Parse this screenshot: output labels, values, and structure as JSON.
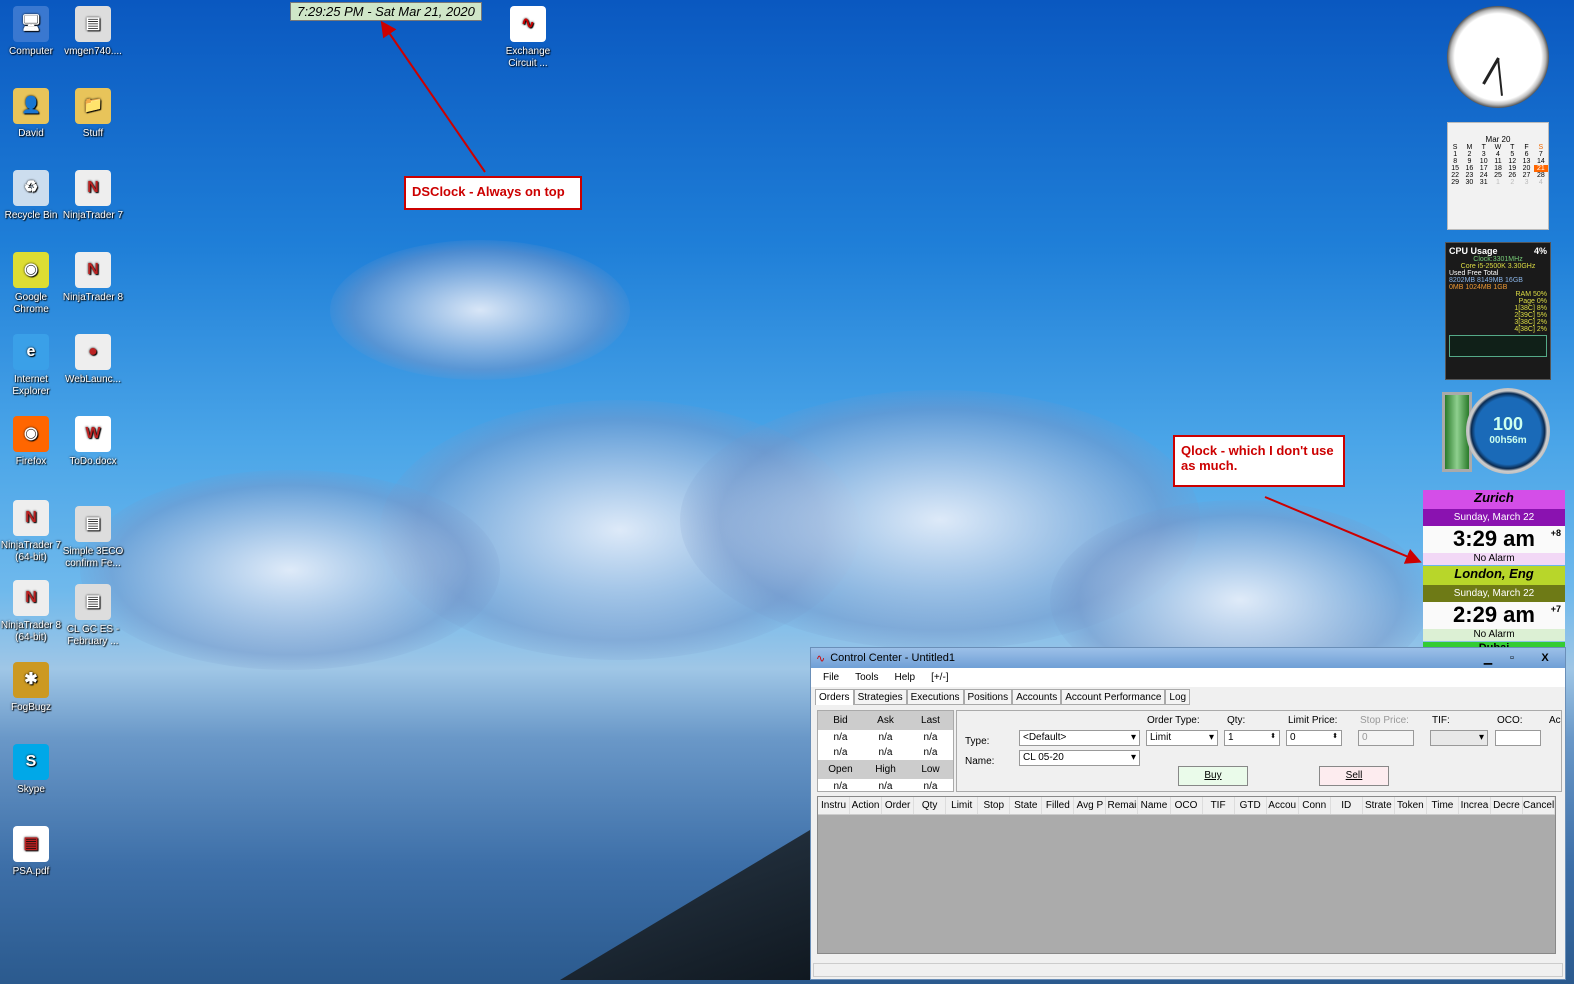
{
  "desktop": {
    "icons_col1": [
      "Computer",
      "David",
      "Recycle Bin",
      "Google Chrome",
      "Internet Explorer",
      "Firefox",
      "NinjaTrader 7 (64-bit)",
      "NinjaTrader 8 (64-bit)",
      "FogBugz",
      "Skype",
      "PSA.pdf"
    ],
    "icons_col2": [
      "vmgen740....",
      "Stuff",
      "NinjaTrader 7",
      "NinjaTrader 8",
      "WebLaunc...",
      "ToDo.docx",
      "Simple 3ECO confirm Fe...",
      "CL GC ES - February ..."
    ],
    "extra_icon": "Exchange Circuit ..."
  },
  "dsclock": "7:29:25 PM - Sat Mar 21, 2020",
  "annotations": {
    "dsclock": "DSClock - Always on top",
    "qlock": "Qlock - which I don't use as much."
  },
  "calendar": {
    "month": "Mar 20",
    "days": [
      "S",
      "M",
      "T",
      "W",
      "T",
      "F",
      "S"
    ],
    "rows": [
      [
        "1",
        "2",
        "3",
        "4",
        "5",
        "6",
        "7"
      ],
      [
        "8",
        "9",
        "10",
        "11",
        "12",
        "13",
        "14"
      ],
      [
        "15",
        "16",
        "17",
        "18",
        "19",
        "20",
        "21"
      ],
      [
        "22",
        "23",
        "24",
        "25",
        "26",
        "27",
        "28"
      ],
      [
        "29",
        "30",
        "31",
        "1",
        "2",
        "3",
        "4"
      ]
    ],
    "today": "21"
  },
  "cpu": {
    "title": "CPU Usage",
    "pct": "4%",
    "clock": "Clock:3301MHz",
    "model": "Core i5-2500K 3.30GHz",
    "cols": "Used   Free   Total",
    "mem1": "8202MB  8149MB  16GB",
    "mem2": "0MB  1024MB  1GB",
    "rows": [
      "RAM 50%",
      "Page 0%",
      "1[38C] 8%",
      "2[39C] 5%",
      "3[38C] 2%",
      "4[38C] 2%"
    ]
  },
  "battery": {
    "pct": "100",
    "time": "00h56m"
  },
  "qlock": [
    {
      "city": "Zurich",
      "date": "Sunday, March 22",
      "time": "3:29 am",
      "offset": "+8",
      "alarm": "No Alarm"
    },
    {
      "city": "London, Eng",
      "date": "Sunday, March 22",
      "time": "2:29 am",
      "offset": "+7",
      "alarm": "No Alarm"
    },
    {
      "city": "Dubai"
    }
  ],
  "window": {
    "title": "Control Center - Untitled1",
    "menu": [
      "File",
      "Tools",
      "Help",
      "[+/-]"
    ],
    "tabs": [
      "Orders",
      "Strategies",
      "Executions",
      "Positions",
      "Accounts",
      "Account Performance",
      "Log"
    ],
    "quote": {
      "h1": [
        "Bid",
        "Ask",
        "Last"
      ],
      "r1": [
        "n/a",
        "n/a",
        "n/a"
      ],
      "r2": [
        "n/a",
        "n/a",
        "n/a"
      ],
      "h2": [
        "Open",
        "High",
        "Low"
      ],
      "r3": [
        "n/a",
        "n/a",
        "n/a"
      ]
    },
    "form": {
      "type_label": "Type:",
      "type_value": "<Default>",
      "name_label": "Name:",
      "name_value": "CL 05-20",
      "order_type_label": "Order Type:",
      "order_type": "Limit",
      "qty_label": "Qty:",
      "qty": "1",
      "limit_label": "Limit Price:",
      "limit": "0",
      "stop_label": "Stop Price:",
      "stop": "0",
      "tif_label": "TIF:",
      "oco_label": "OCO:",
      "ac_label": "Ac",
      "buy": "Buy",
      "sell": "Sell"
    },
    "columns": [
      "Instru",
      "Action",
      "Order",
      "Qty",
      "Limit",
      "Stop",
      "State",
      "Filled",
      "Avg P",
      "Remai",
      "Name",
      "OCO",
      "TIF",
      "GTD",
      "Accou",
      "Conn",
      "ID",
      "Strate",
      "Token",
      "Time",
      "Increa",
      "Decre",
      "Cancel"
    ]
  }
}
